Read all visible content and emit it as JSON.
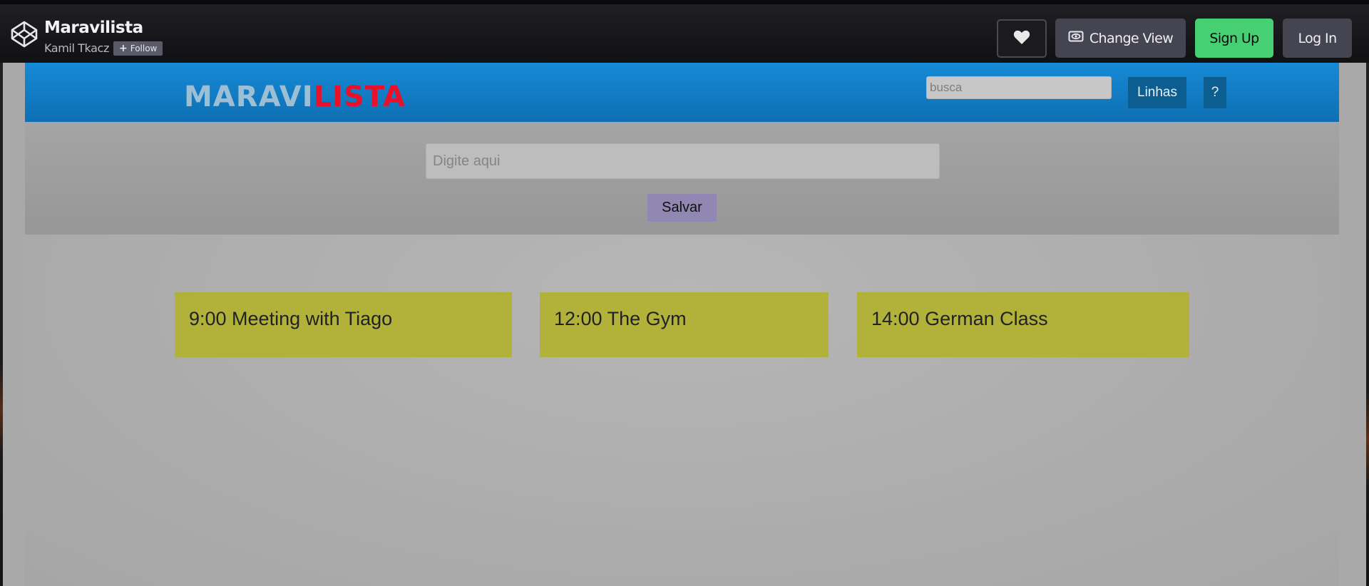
{
  "codepen_bar": {
    "pen_title": "Maravilista",
    "author": "Kamil Tkacz",
    "follow_label": "Follow",
    "follow_icon": "plus-icon",
    "like_icon": "heart-icon",
    "change_view_label": "Change View",
    "change_view_icon": "eye-icon",
    "signup_label": "Sign Up",
    "login_label": "Log In",
    "logo_icon": "codepen-logo-icon"
  },
  "app": {
    "brand_part1": "MARAVI",
    "brand_part2": "LISTA",
    "search_placeholder": "busca",
    "linhas_label": "Linhas",
    "help_label": "?",
    "entry_placeholder": "Digite aqui",
    "save_label": "Salvar",
    "tasks": [
      {
        "text": "9:00 Meeting with Tiago"
      },
      {
        "text": "12:00 The Gym"
      },
      {
        "text": "14:00 German Class"
      }
    ]
  },
  "colors": {
    "brand_light": "#9cbfd6",
    "brand_red": "#e8112b",
    "header_blue": "#168ad6",
    "button_blue": "#0d5e90",
    "card_yellow": "#b2b23b",
    "save_purple": "#9087b3",
    "signup_green": "#47cf73"
  }
}
